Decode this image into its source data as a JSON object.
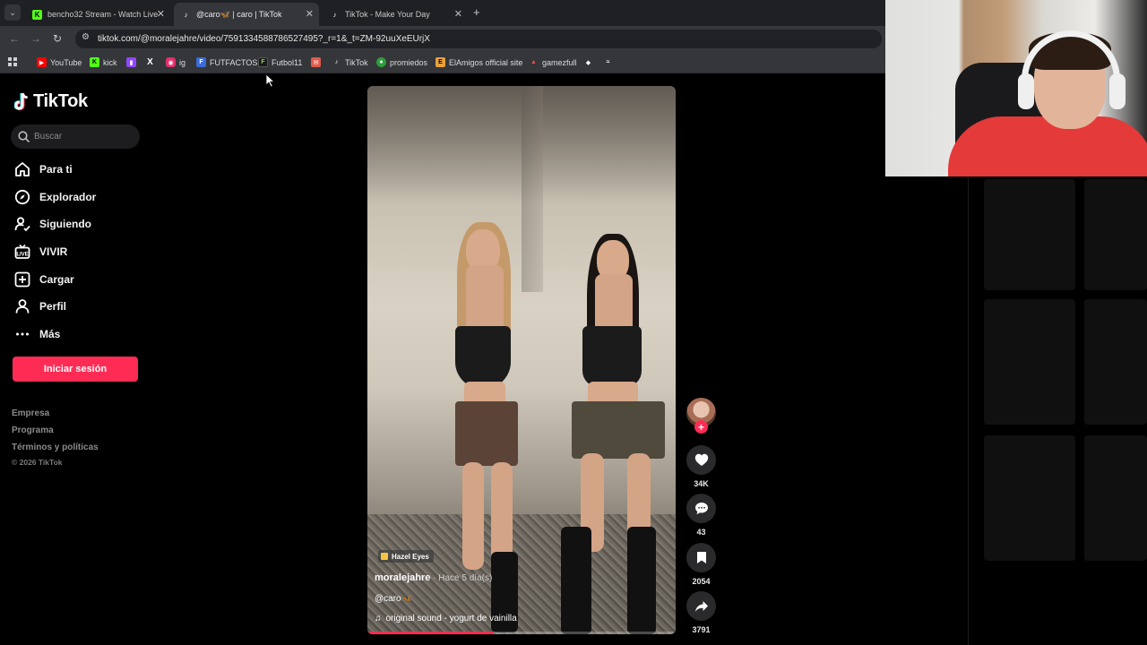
{
  "browser": {
    "tabs": [
      {
        "title": "bencho32 Stream - Watch Live",
        "icon": "kick-icon",
        "active": false
      },
      {
        "title": "@caro🦋 | caro | TikTok",
        "icon": "tiktok-icon",
        "active": true
      },
      {
        "title": "TikTok - Make Your Day",
        "icon": "tiktok-icon",
        "active": false
      }
    ],
    "url": "tiktok.com/@moralejahre/video/7591334588786527495?_r=1&_t=ZM-92uuXeEUrjX",
    "bookmarks": [
      {
        "label": "YouTube",
        "icon": "youtube-icon",
        "color": "#ff0000"
      },
      {
        "label": "kick",
        "icon": "kick-icon",
        "color": "#53fc18"
      },
      {
        "label": "",
        "icon": "twitch-icon",
        "color": "#9146ff"
      },
      {
        "label": "",
        "icon": "x-icon",
        "color": "#ffffff"
      },
      {
        "label": "ig",
        "icon": "instagram-icon",
        "color": "#e1306c"
      },
      {
        "label": "FUTFACTOS",
        "icon": "futfactos-icon",
        "color": "#3b6bd6"
      },
      {
        "label": "Futbol11",
        "icon": "futbol11-icon",
        "color": "#1a1a1a"
      },
      {
        "label": "",
        "icon": "mail-icon",
        "color": "#e05a4b"
      },
      {
        "label": "TikTok",
        "icon": "tiktok-icon",
        "color": "#ffffff"
      },
      {
        "label": "promiedos",
        "icon": "promiedos-icon",
        "color": "#2e9e3a"
      },
      {
        "label": "ElAmigos official site",
        "icon": "elamigos-icon",
        "color": "#e8a13a"
      },
      {
        "label": "gamezfull",
        "icon": "gamezfull-icon",
        "color": "#b03030"
      },
      {
        "label": "",
        "icon": "diamond-icon",
        "color": "#ffffff"
      },
      {
        "label": "",
        "icon": "translate-icon",
        "color": "#ffffff"
      }
    ]
  },
  "tiktok": {
    "logo_text": "TikTok",
    "search_placeholder": "Buscar",
    "nav": [
      {
        "label": "Para ti",
        "icon": "home-icon"
      },
      {
        "label": "Explorador",
        "icon": "compass-icon"
      },
      {
        "label": "Siguiendo",
        "icon": "following-icon"
      },
      {
        "label": "VIVIR",
        "icon": "live-icon"
      },
      {
        "label": "Cargar",
        "icon": "upload-icon"
      },
      {
        "label": "Perfil",
        "icon": "profile-icon"
      },
      {
        "label": "Más",
        "icon": "more-icon"
      }
    ],
    "login_button": "Iniciar sesión",
    "footer": [
      "Empresa",
      "Programa",
      "Términos y políticas"
    ],
    "copyright": "© 2026 TikTok",
    "brand_color": "#fe2c55"
  },
  "video": {
    "sticker": "Hazel Eyes",
    "author": "moralejahre",
    "time_ago": " · Hace 5 día(s)",
    "caption": "@caro🦋",
    "sound": "original sound - yogurt de vainilla",
    "progress_fraction": 0.41,
    "likes": "34K",
    "comments": "43",
    "saves": "2054",
    "shares": "3791"
  }
}
